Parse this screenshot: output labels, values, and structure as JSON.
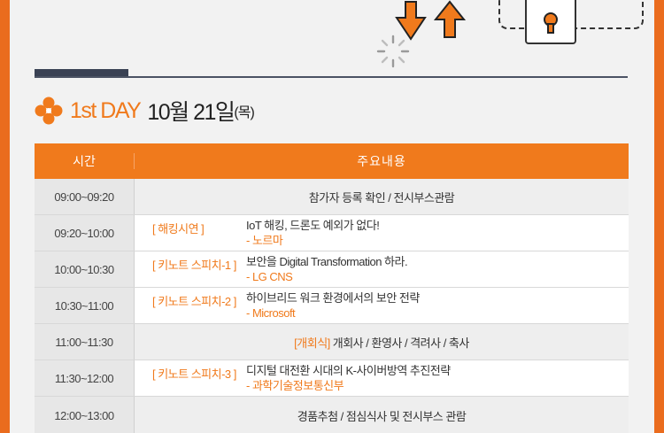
{
  "colors": {
    "accent": "#f07a1c",
    "frame": "#ea6c1e",
    "panel": "#f2f2f2",
    "divider": "#3a4254"
  },
  "icons": {
    "arrows": "up-down-arrows-icon",
    "spinner": "loading-spinner-icon",
    "lock": "keyhole-lock-icon",
    "flower": "orange-flower-bullet-icon"
  },
  "heading": {
    "day": "1st DAY",
    "date": "10월 21일",
    "dow": "(목)"
  },
  "table": {
    "header_time": "시간",
    "header_content": "주요내용",
    "rows": [
      {
        "time": "09:00~09:20",
        "title": "참가자 등록 확인 / 전시부스관람"
      },
      {
        "time": "09:20~10:00",
        "tag": "[ 해킹시연 ]",
        "title": "IoT 해킹, 드론도 예외가 없다!",
        "speaker": "- 노르마"
      },
      {
        "time": "10:00~10:30",
        "tag": "[ 키노트 스피치-1 ]",
        "title": "보안을 Digital Transformation 하라.",
        "speaker": "- LG CNS"
      },
      {
        "time": "10:30~11:00",
        "tag": "[ 키노트 스피치-2 ]",
        "title": "하이브리드 워크 환경에서의 보안 전략",
        "speaker": "- Microsoft"
      },
      {
        "time": "11:00~11:30",
        "tag": "[개회식]",
        "title": "개회사 / 환영사 / 격려사 / 축사"
      },
      {
        "time": "11:30~12:00",
        "tag": "[ 키노트 스피치-3 ]",
        "title": "디지털 대전환 시대의 K-사이버방역 추진전략",
        "speaker": "- 과학기술정보통신부"
      },
      {
        "time": "12:00~13:00",
        "title": "경품추첨 / 점심식사 및 전시부스 관람"
      }
    ]
  }
}
